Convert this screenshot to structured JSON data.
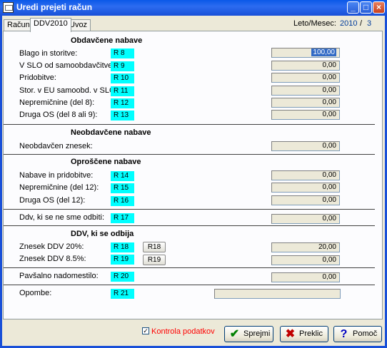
{
  "window": {
    "title": "Uredi prejeti račun"
  },
  "tabs": [
    {
      "label": "Račun"
    },
    {
      "label": "DDV2010"
    },
    {
      "label": "Uvoz"
    }
  ],
  "period": {
    "label": "Leto/Mesec:",
    "year": "2010",
    "separator": "/",
    "month": "3"
  },
  "sections": {
    "obdavcene": "Obdavčene nabave",
    "neobdavcene": "Neobdavčene nabave",
    "oproscene": "Oproščene nabave",
    "ddv": "DDV, ki se odbija"
  },
  "rows": {
    "blago": {
      "label": "Blago in storitve:",
      "code": "R 8",
      "value": "100,00"
    },
    "vslo": {
      "label": "V SLO od samoobdavčitve:",
      "code": "R 9",
      "value": "0,00"
    },
    "pridobitve": {
      "label": "Pridobitve:",
      "code": "R 10",
      "value": "0,00"
    },
    "stor": {
      "label": "Stor. v EU samoobd. v SLO:",
      "code": "R 11",
      "value": "0,00"
    },
    "neprem8": {
      "label": "Nepremičnine (del 8):",
      "code": "R 12",
      "value": "0,00"
    },
    "drugaos8": {
      "label": "Druga OS (del 8 ali 9):",
      "code": "R 13",
      "value": "0,00"
    },
    "neobdavcen": {
      "label": "Neobdavčen znesek:",
      "value": "0,00"
    },
    "nabave": {
      "label": "Nabave in pridobitve:",
      "code": "R 14",
      "value": "0,00"
    },
    "neprem12": {
      "label": "Nepremičnine (del 12):",
      "code": "R 15",
      "value": "0,00"
    },
    "drugaos12": {
      "label": "Druga OS (del 12):",
      "code": "R 16",
      "value": "0,00"
    },
    "ddvne": {
      "label": "Ddv, ki se ne sme odbiti:",
      "code": "R 17",
      "value": "0,00"
    },
    "ddv20": {
      "label": "Znesek DDV 20%:",
      "code": "R 18",
      "button": "R18",
      "value": "20,00"
    },
    "ddv85": {
      "label": "Znesek DDV 8.5%:",
      "code": "R 19",
      "button": "R19",
      "value": "0,00"
    },
    "pavsal": {
      "label": "Pavšalno nadomestilo:",
      "code": "R 20",
      "value": "0,00"
    },
    "opombe": {
      "label": "Opombe:",
      "code": "R 21",
      "value": ""
    }
  },
  "footer": {
    "checkbox_label": "Kontrola podatkov",
    "checkbox_color": "#ff0000",
    "accept": "Sprejmi",
    "cancel": "Preklic",
    "help": "Pomoč"
  },
  "colors": {
    "code_bg": "#00ffff",
    "titlebar": "#0a58e8",
    "accept_icon": "#008000",
    "cancel_icon": "#c00000",
    "help_icon": "#0000c0"
  }
}
